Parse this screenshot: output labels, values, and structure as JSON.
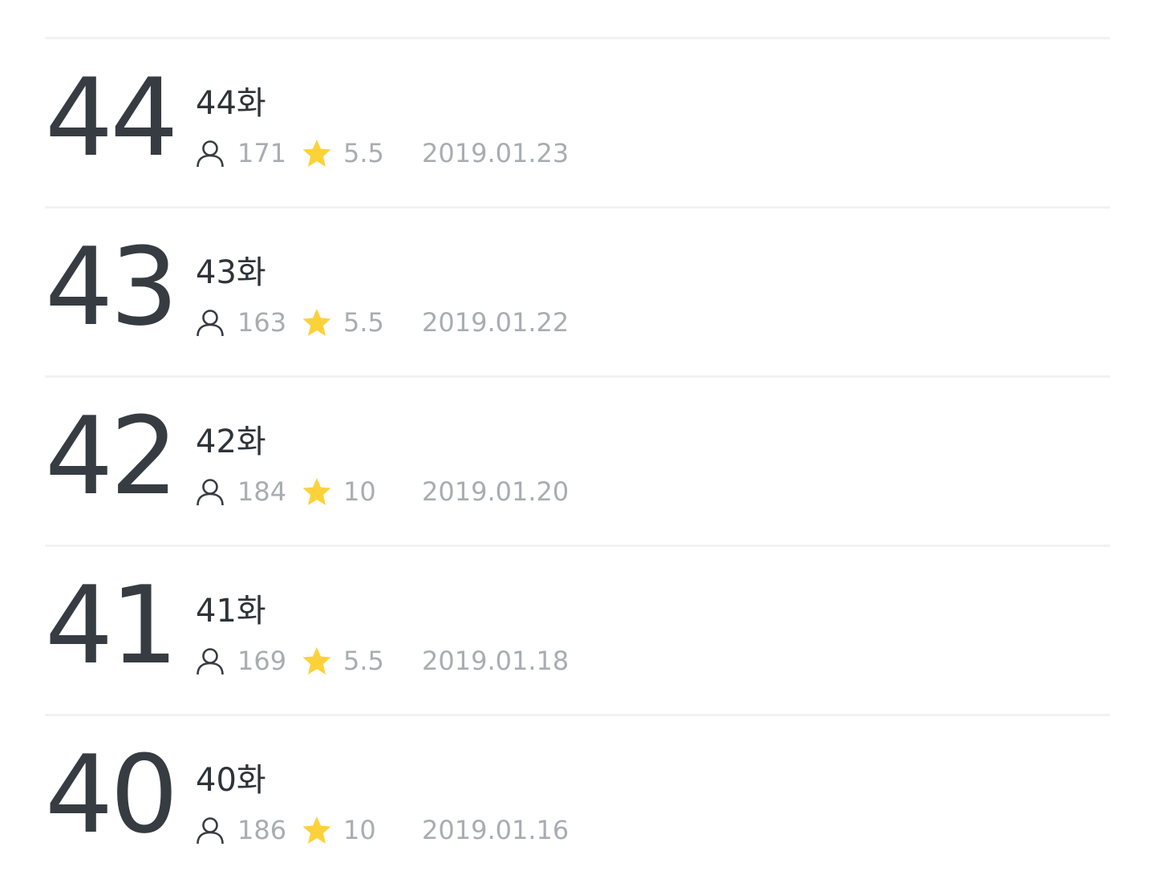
{
  "colors": {
    "number": "#373c42",
    "title": "#2e3338",
    "meta": "#a9adb1",
    "star": "#fcd23a",
    "divider": "#f1f2f3"
  },
  "icons": {
    "views": "person-icon",
    "rating": "star-icon"
  },
  "episodes": [
    {
      "number": "44",
      "title": "44화",
      "views": "171",
      "rating": "5.5",
      "date": "2019.01.23"
    },
    {
      "number": "43",
      "title": "43화",
      "views": "163",
      "rating": "5.5",
      "date": "2019.01.22"
    },
    {
      "number": "42",
      "title": "42화",
      "views": "184",
      "rating": "10",
      "date": "2019.01.20"
    },
    {
      "number": "41",
      "title": "41화",
      "views": "169",
      "rating": "5.5",
      "date": "2019.01.18"
    },
    {
      "number": "40",
      "title": "40화",
      "views": "186",
      "rating": "10",
      "date": "2019.01.16"
    }
  ]
}
